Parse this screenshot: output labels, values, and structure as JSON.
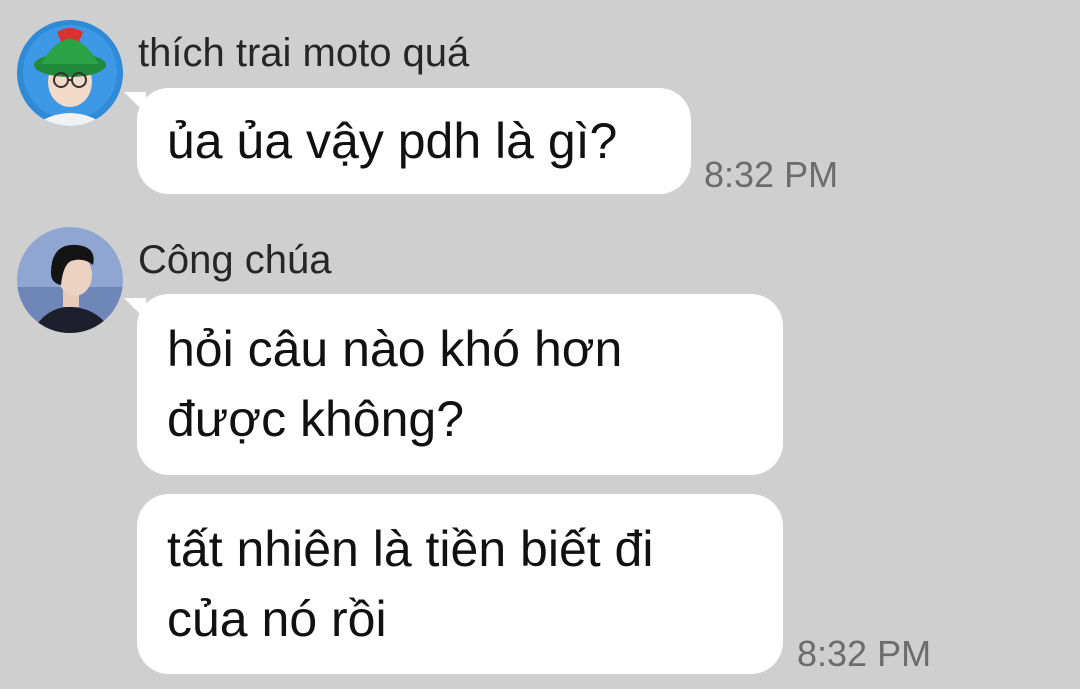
{
  "conversation": {
    "group1": {
      "sender": "thích trai moto quá",
      "messages": [
        {
          "lines": [
            "ủa ủa vậy pdh là gì?"
          ]
        }
      ],
      "time": "8:32 PM"
    },
    "group2": {
      "sender": "Công chúa",
      "messages": [
        {
          "lines": [
            "hỏi câu nào khó hơn",
            "được không?"
          ]
        },
        {
          "lines": [
            "tất nhiên là tiền biết đi",
            "của nó rồi"
          ]
        }
      ],
      "time": "8:32 PM"
    }
  },
  "colors": {
    "background": "#cfcfcf",
    "bubble": "#ffffff",
    "timestamp": "#6c6c6c"
  }
}
